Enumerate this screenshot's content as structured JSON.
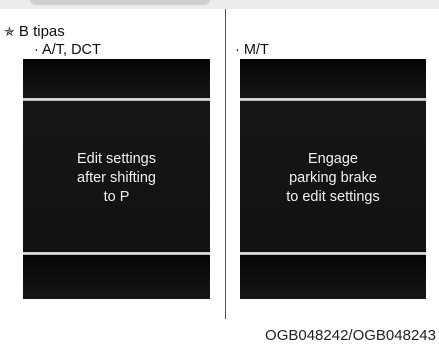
{
  "note": {
    "marker_icon": "star-icon",
    "text": "B tipas"
  },
  "panels": [
    {
      "label": "· A/T, DCT",
      "message_lines": [
        "Edit settings",
        "after shifting",
        "to P"
      ]
    },
    {
      "label": "· M/T",
      "message_lines": [
        "Engage",
        "parking brake",
        "to edit settings"
      ]
    }
  ],
  "figure_code": "OGB048242/OGB048243"
}
